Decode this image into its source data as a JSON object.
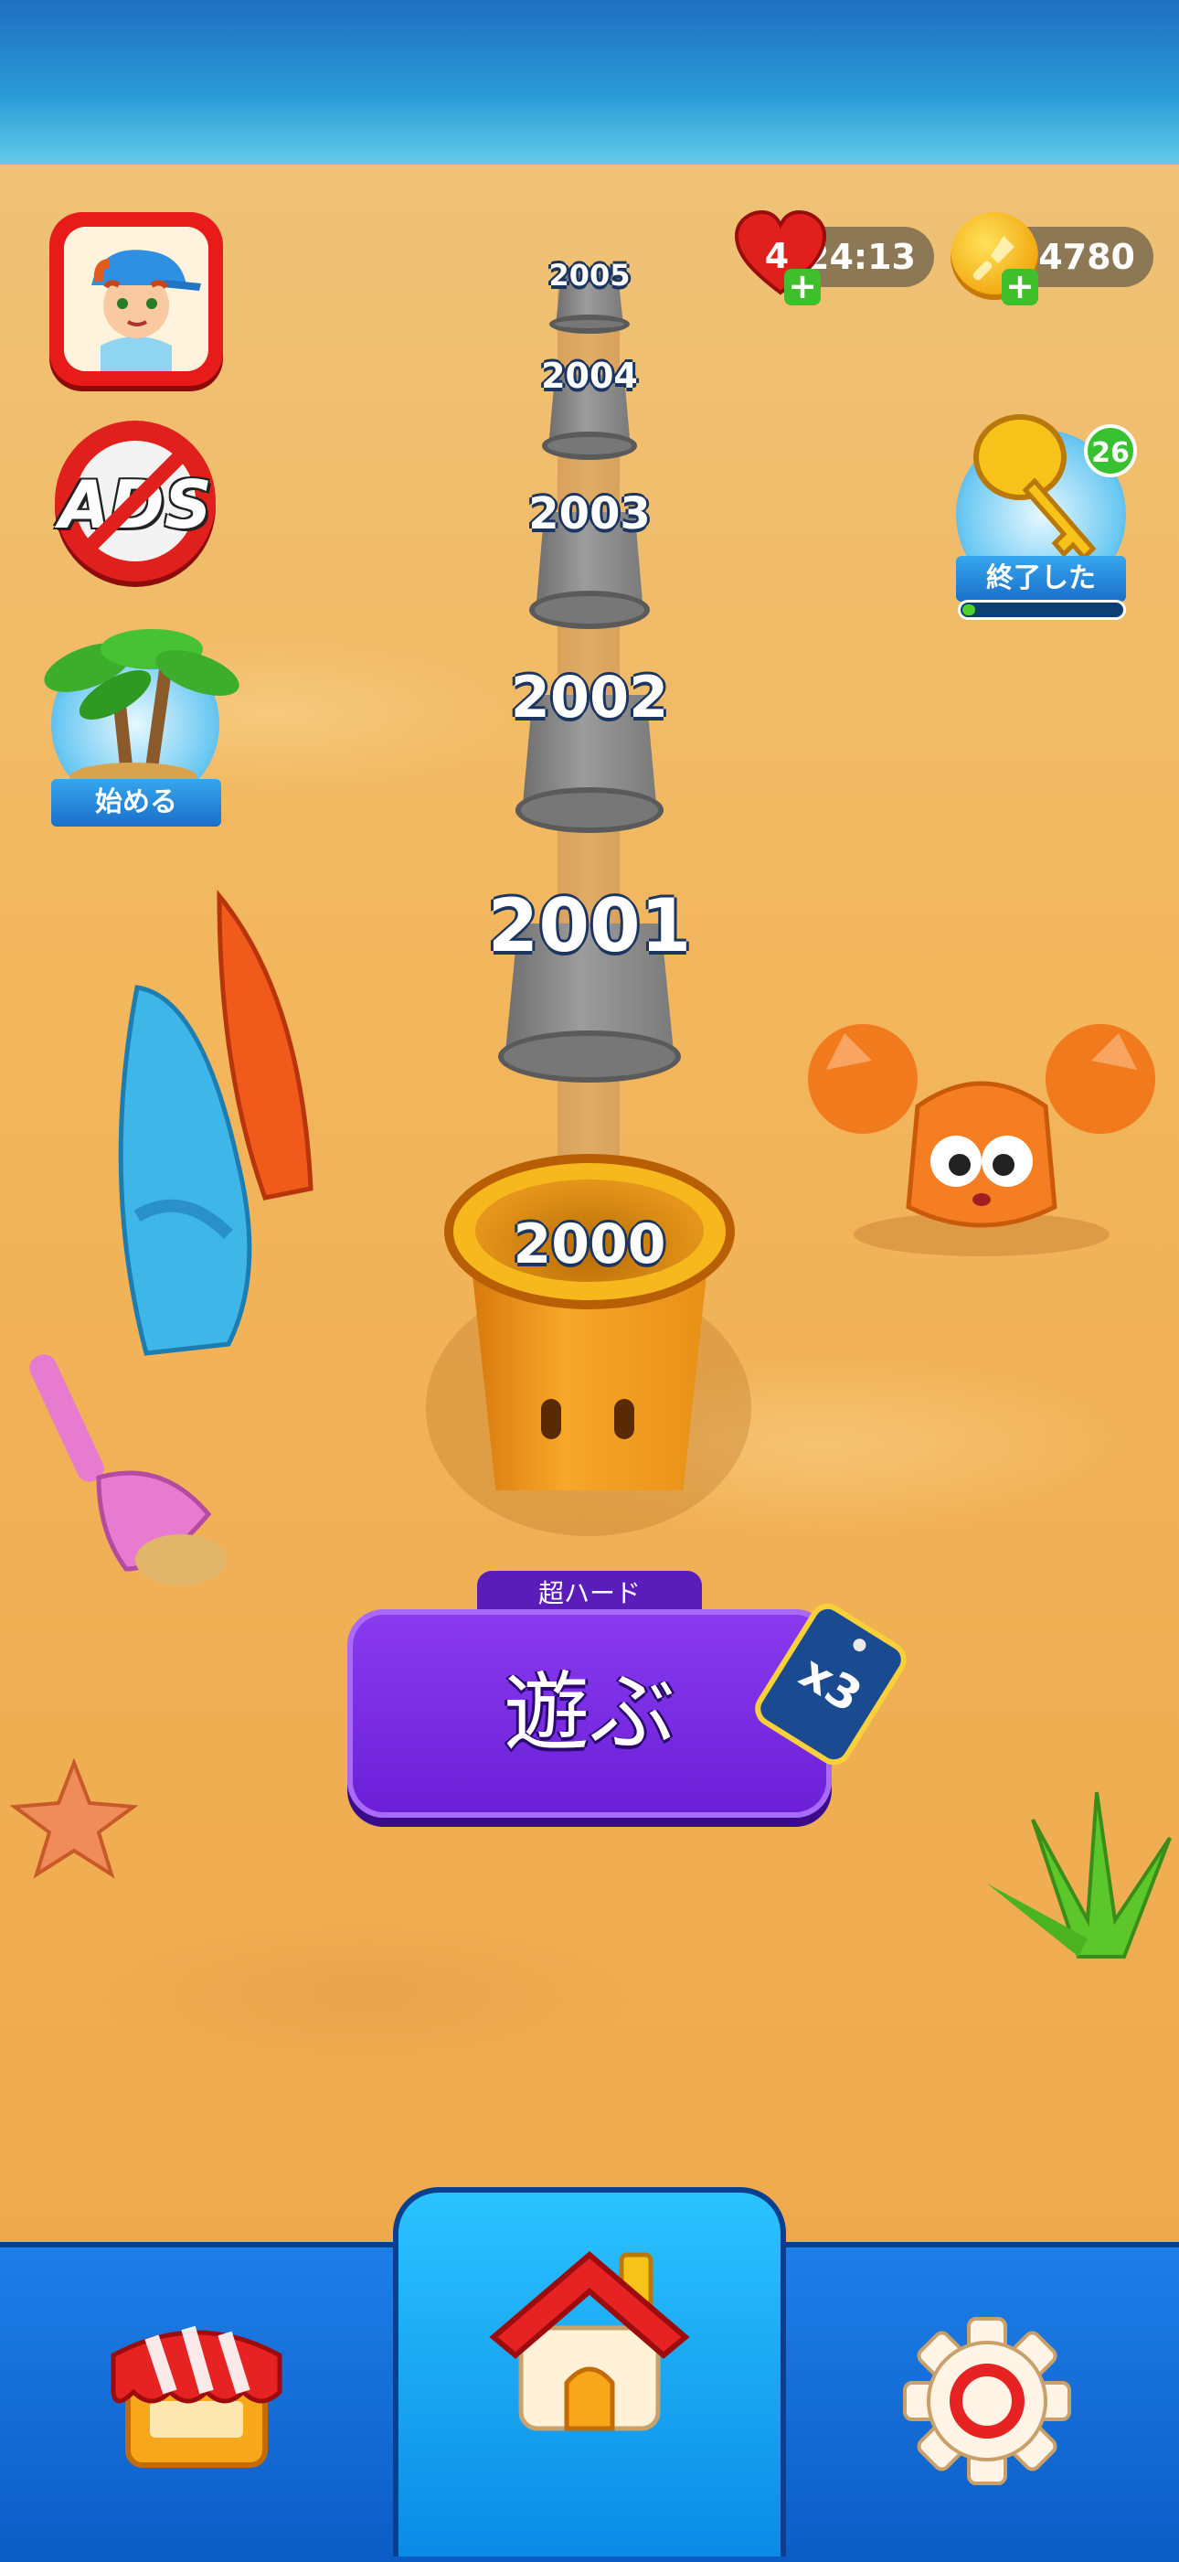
{
  "topbar": {
    "lives": "4",
    "lives_timer": "24:13",
    "coins": "34780",
    "plus_symbol": "+"
  },
  "left_menu": {
    "no_ads_text": "ADS",
    "island_label": "始める"
  },
  "event": {
    "badge_count": "26",
    "label": "終了した",
    "progress": 0.05
  },
  "levels": [
    "2005",
    "2004",
    "2003",
    "2002",
    "2001"
  ],
  "current_level": "2000",
  "play": {
    "difficulty": "超ハード",
    "label": "遊ぶ",
    "multiplier": "x3"
  },
  "nav": {
    "items": [
      "shop-icon",
      "home-icon",
      "settings-icon"
    ]
  },
  "colors": {
    "play_button": "#7a2fe6",
    "nav": "#1572dd",
    "accent_green": "#3fbf2a"
  }
}
